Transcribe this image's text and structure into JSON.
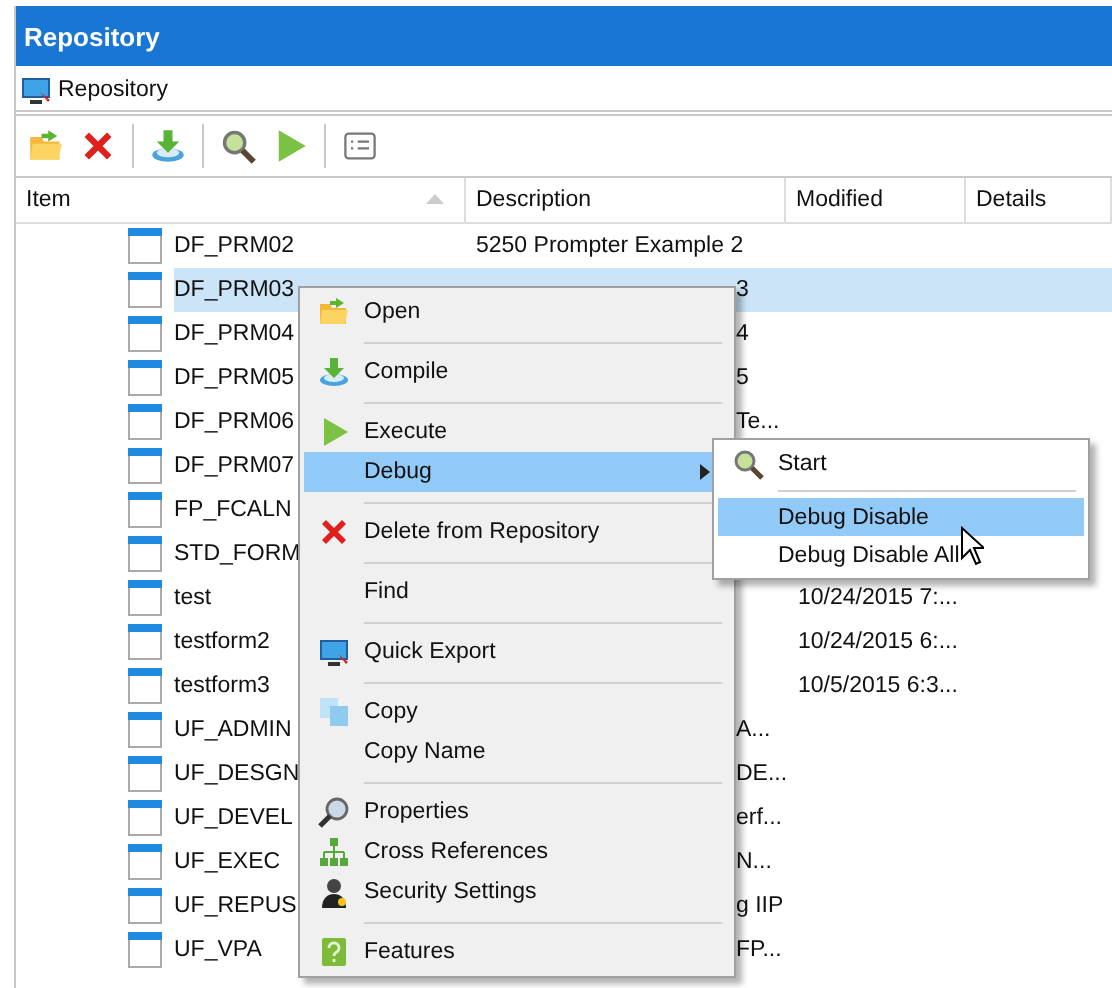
{
  "window": {
    "title": "Repository"
  },
  "breadcrumb": {
    "label": "Repository"
  },
  "table": {
    "columns": [
      {
        "label": "Item",
        "sorted": true
      },
      {
        "label": "Description",
        "sorted": false
      },
      {
        "label": "Modified",
        "sorted": false
      },
      {
        "label": "Details",
        "sorted": false
      }
    ],
    "rows": [
      {
        "item": "DF_PRM02",
        "description": "5250 Prompter Example 2",
        "selected": false
      },
      {
        "item": "DF_PRM03",
        "description": "3",
        "covered": true,
        "selected": true
      },
      {
        "item": "DF_PRM04",
        "description": "4",
        "covered": true,
        "selected": false
      },
      {
        "item": "DF_PRM05",
        "description": "5",
        "covered": true,
        "selected": false
      },
      {
        "item": "DF_PRM06",
        "description": "Te...",
        "covered": true,
        "selected": false
      },
      {
        "item": "DF_PRM07",
        "selected": false
      },
      {
        "item": "FP_FCALN",
        "selected": false
      },
      {
        "item": "STD_FORM",
        "selected": false
      },
      {
        "item": "test",
        "modified": "10/24/2015 7:...",
        "selected": false
      },
      {
        "item": "testform2",
        "modified": "10/24/2015 6:...",
        "selected": false
      },
      {
        "item": "testform3",
        "modified": "10/5/2015 6:3...",
        "selected": false
      },
      {
        "item": "UF_ADMIN",
        "description": "A...",
        "covered": true,
        "selected": false
      },
      {
        "item": "UF_DESGN",
        "description": "DE...",
        "covered": true,
        "selected": false
      },
      {
        "item": "UF_DEVEL",
        "description": "erf...",
        "covered": true,
        "selected": false
      },
      {
        "item": "UF_EXEC",
        "description": "N...",
        "covered": true,
        "selected": false
      },
      {
        "item": "UF_REPUS",
        "description": "g IIP",
        "covered": true,
        "selected": false
      },
      {
        "item": "UF_VPA",
        "description": "FP...",
        "covered": true,
        "selected": false
      }
    ]
  },
  "context_menu": {
    "groups": [
      [
        {
          "label": "Open",
          "selected": false
        }
      ],
      [
        {
          "label": "Compile",
          "selected": false
        }
      ],
      [
        {
          "label": "Execute",
          "selected": false
        },
        {
          "label": "Debug",
          "selected": true,
          "submenu": true
        }
      ],
      [
        {
          "label": "Delete from Repository",
          "selected": false
        }
      ],
      [
        {
          "label": "Find",
          "selected": false
        }
      ],
      [
        {
          "label": "Quick Export",
          "selected": false
        }
      ],
      [
        {
          "label": "Copy",
          "selected": false
        },
        {
          "label": "Copy Name",
          "selected": false
        }
      ],
      [
        {
          "label": "Properties",
          "selected": false
        },
        {
          "label": "Cross References",
          "selected": false
        },
        {
          "label": "Security Settings",
          "selected": false
        }
      ],
      [
        {
          "label": "Features",
          "selected": false
        }
      ]
    ]
  },
  "submenu": {
    "groups": [
      [
        {
          "label": "Start",
          "selected": false
        }
      ],
      [
        {
          "label": "Debug Disable",
          "selected": true
        },
        {
          "label": "Debug Disable All",
          "selected": false
        }
      ]
    ]
  }
}
